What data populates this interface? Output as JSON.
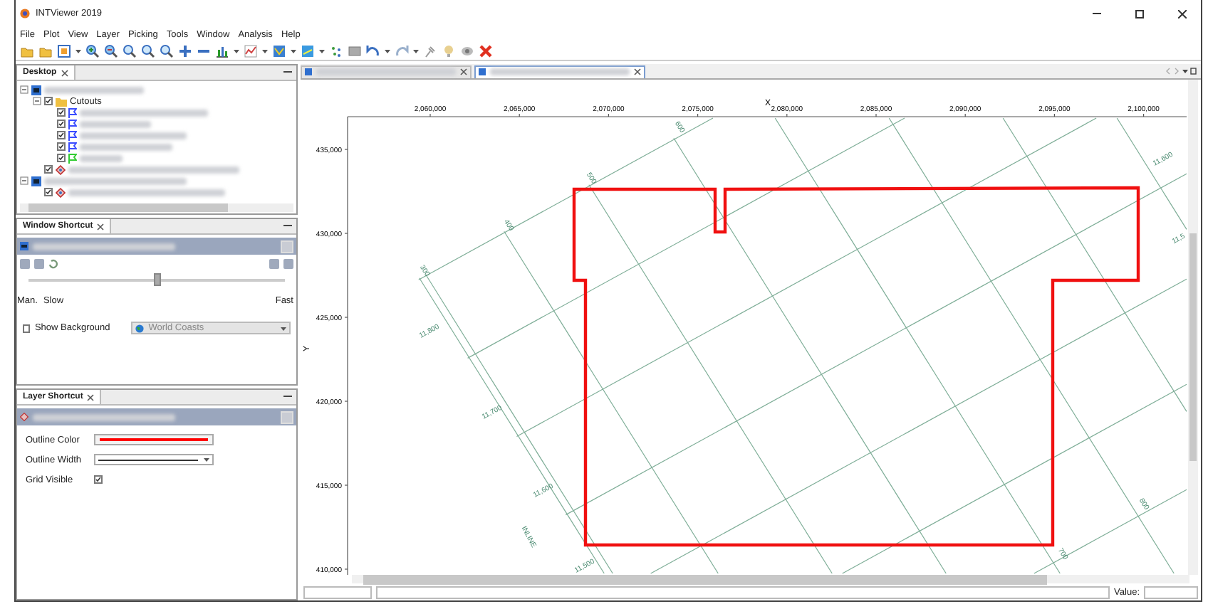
{
  "window": {
    "title": "INTViewer 2019"
  },
  "menu": [
    {
      "label": "File"
    },
    {
      "label": "Plot"
    },
    {
      "label": "View"
    },
    {
      "label": "Layer"
    },
    {
      "label": "Picking"
    },
    {
      "label": "Tools"
    },
    {
      "label": "Window"
    },
    {
      "label": "Analysis"
    },
    {
      "label": "Help"
    }
  ],
  "desktop": {
    "title": "Desktop",
    "tree": [
      {
        "kind": "view",
        "expanded": true,
        "children": [
          {
            "kind": "folder",
            "label": "Cutouts",
            "checked": true,
            "expanded": true,
            "children": [
              {
                "kind": "flag",
                "checked": true,
                "color": "#3a4cff"
              },
              {
                "kind": "flag",
                "checked": true,
                "color": "#3a4cff"
              },
              {
                "kind": "flag",
                "checked": true,
                "color": "#3a4cff"
              },
              {
                "kind": "flag",
                "checked": true,
                "color": "#3a4cff"
              },
              {
                "kind": "flag",
                "checked": true,
                "color": "#33cc33"
              }
            ]
          },
          {
            "kind": "layer",
            "checked": true
          }
        ]
      },
      {
        "kind": "view",
        "expanded": true,
        "children": [
          {
            "kind": "layer",
            "checked": true
          }
        ]
      }
    ]
  },
  "window_shortcut": {
    "title": "Window Shortcut",
    "slider": {
      "level": 0.5
    },
    "speed_labels": [
      "Man.",
      "Slow"
    ],
    "fast_label": "Fast",
    "show_background": {
      "label": "Show Background",
      "checked": false
    },
    "background_layer": {
      "value": "World Coasts",
      "disabled": true
    }
  },
  "layer_shortcut": {
    "title": "Layer Shortcut",
    "properties": [
      {
        "kind": "color",
        "label": "Outline Color",
        "color": "#ff0000"
      },
      {
        "kind": "line",
        "label": "Outline Width"
      },
      {
        "kind": "checkbox",
        "label": "Grid Visible",
        "checked": true
      }
    ]
  },
  "view_tabs": [
    {
      "selected": false
    },
    {
      "selected": true
    }
  ],
  "map": {
    "x_label": "X",
    "y_label": "Y",
    "x_ticks": [
      "2,060,000",
      "2,065,000",
      "2,070,000",
      "2,075,000",
      "2,080,000",
      "2,085,000",
      "2,090,000",
      "2,095,000",
      "2,100,000"
    ],
    "y_ticks": [
      "435,000",
      "430,000",
      "425,000",
      "420,000",
      "415,000",
      "410,000"
    ],
    "grid_labels": [
      "600",
      "500",
      "400",
      "300",
      "11,600",
      "11,5",
      "11,800",
      "11,700",
      "11,600",
      "INLINE",
      "11,500",
      "800",
      "700"
    ]
  },
  "status_bar": {
    "value_label": "Value:"
  }
}
